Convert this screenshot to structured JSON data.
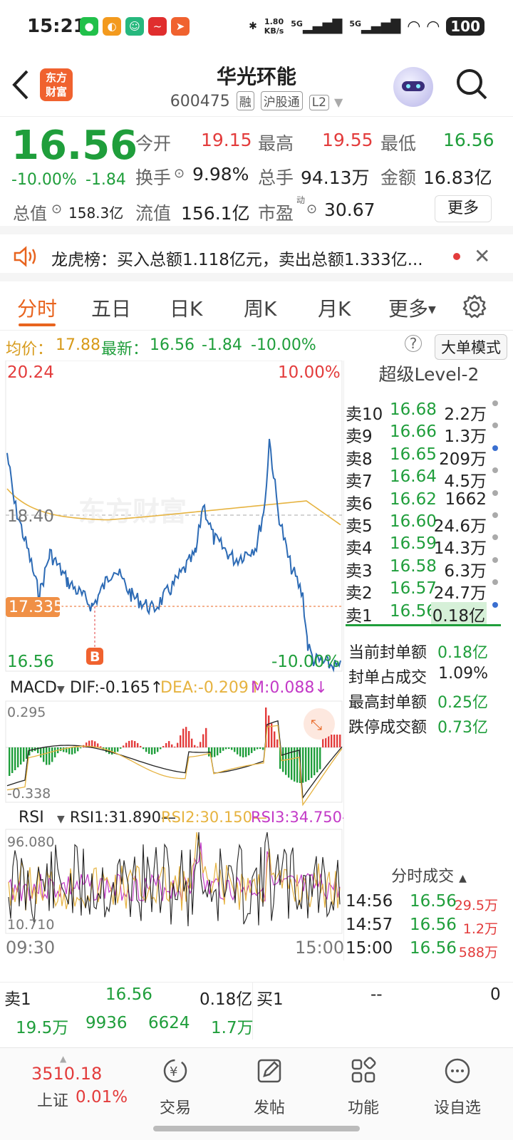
{
  "status_bar": {
    "time": "15:21",
    "net_speed": "1.80\nKB/s",
    "net_speed_top": "1.80",
    "net_speed_bottom": "KB/s",
    "signal1": "5G",
    "signal2": "5G",
    "battery": "100"
  },
  "header": {
    "logo_line1": "东方",
    "logo_line2": "财富",
    "stock_name": "华光环能",
    "stock_code": "600475",
    "tag_rong": "融",
    "tag_hgt": "沪股通",
    "tag_l2": "L2"
  },
  "quote": {
    "price": "16.56",
    "change_pct": "-10.00%",
    "change": "-1.84",
    "open_label": "今开",
    "open": "19.15",
    "high_label": "最高",
    "high": "19.55",
    "low_label": "最低",
    "low": "16.56",
    "turnover_label": "换手",
    "turnover": "9.98%",
    "volume_label": "总手",
    "volume": "94.13万",
    "amount_label": "金额",
    "amount": "16.83亿",
    "mktcap_label": "总值",
    "mktcap": "158.3亿",
    "float_label": "流值",
    "float": "156.1亿",
    "pe_label": "市盈",
    "pe_sup": "动",
    "pe": "30.67",
    "more_button": "更多"
  },
  "notice": {
    "text": "龙虎榜：买入总额1.118亿元，卖出总额1.333亿..."
  },
  "tabs": [
    {
      "label": "分时"
    },
    {
      "label": "五日"
    },
    {
      "label": "日K"
    },
    {
      "label": "周K"
    },
    {
      "label": "月K"
    },
    {
      "label": "更多"
    }
  ],
  "infobar": {
    "avg_label": "均价：",
    "avg": "17.88",
    "latest_label": "最新：",
    "latest": "16.56",
    "change": "-1.84",
    "change_pct": "-10.00%",
    "mode_button": "大单模式"
  },
  "chart_labels": {
    "top_price": "20.24",
    "top_pct": "10.00%",
    "mid_price": "18.40",
    "buy_marker_price": "17.335",
    "bottom_price": "16.56",
    "bottom_pct": "-10.00%",
    "marker": "B",
    "watermark": "东方财富"
  },
  "macd": {
    "name": "MACD",
    "dif": "DIF:-0.165↑",
    "dea": "DEA:-0.209↑",
    "m": "M:0.088↓",
    "max": "0.295",
    "min": "-0.338"
  },
  "rsi": {
    "name": "RSI",
    "rsi1": "RSI1:31.890—",
    "rsi2": "RSI2:30.150—",
    "rsi3": "RSI3:34.750—",
    "max": "96.080",
    "min": "10.710",
    "time_start": "09:30",
    "time_end": "15:00"
  },
  "level2": {
    "title": "超级Level-2",
    "asks": [
      {
        "label": "卖10",
        "price": "16.68",
        "vol": "2.2万"
      },
      {
        "label": "卖9",
        "price": "16.66",
        "vol": "1.3万"
      },
      {
        "label": "卖8",
        "price": "16.65",
        "vol": "209万"
      },
      {
        "label": "卖7",
        "price": "16.64",
        "vol": "4.5万"
      },
      {
        "label": "卖6",
        "price": "16.62",
        "vol": "1662"
      },
      {
        "label": "卖5",
        "price": "16.60",
        "vol": "24.6万"
      },
      {
        "label": "卖4",
        "price": "16.59",
        "vol": "14.3万"
      },
      {
        "label": "卖3",
        "price": "16.58",
        "vol": "6.3万"
      },
      {
        "label": "卖2",
        "price": "16.57",
        "vol": "24.7万"
      },
      {
        "label": "卖1",
        "price": "16.56",
        "vol": "0.18亿"
      }
    ],
    "stats": [
      {
        "label": "当前封单额",
        "value": "0.18亿"
      },
      {
        "label": "封单占成交",
        "value": "1.09%"
      },
      {
        "label": "最高封单额",
        "value": "0.25亿"
      },
      {
        "label": "跌停成交额",
        "value": "0.73亿"
      }
    ],
    "ticks_title": "分时成交",
    "ticks": [
      {
        "time": "14:56",
        "price": "16.56",
        "vol": "29.5万"
      },
      {
        "time": "14:57",
        "price": "16.56",
        "vol": "1.2万"
      },
      {
        "time": "15:00",
        "price": "16.56",
        "vol": "588万"
      }
    ]
  },
  "bottom_table": {
    "sell_label": "卖1",
    "sell_price": "16.56",
    "sell_vol": "0.18亿",
    "buy_label": "买1",
    "buy_price": "--",
    "buy_vol": "0",
    "row": [
      "19.5万",
      "9936",
      "6624",
      "1.7万"
    ]
  },
  "navbar": {
    "index_value": "3510.18",
    "index_name": "上证",
    "index_change": "0.01%",
    "trade": "交易",
    "post": "发帖",
    "func": "功能",
    "watch": "设自选"
  },
  "colors": {
    "up": "#e33c3c",
    "down": "#1f9e3b",
    "accent": "#e8641f",
    "price_line": "#2d6bb5",
    "avg_line": "#e6b340"
  }
}
